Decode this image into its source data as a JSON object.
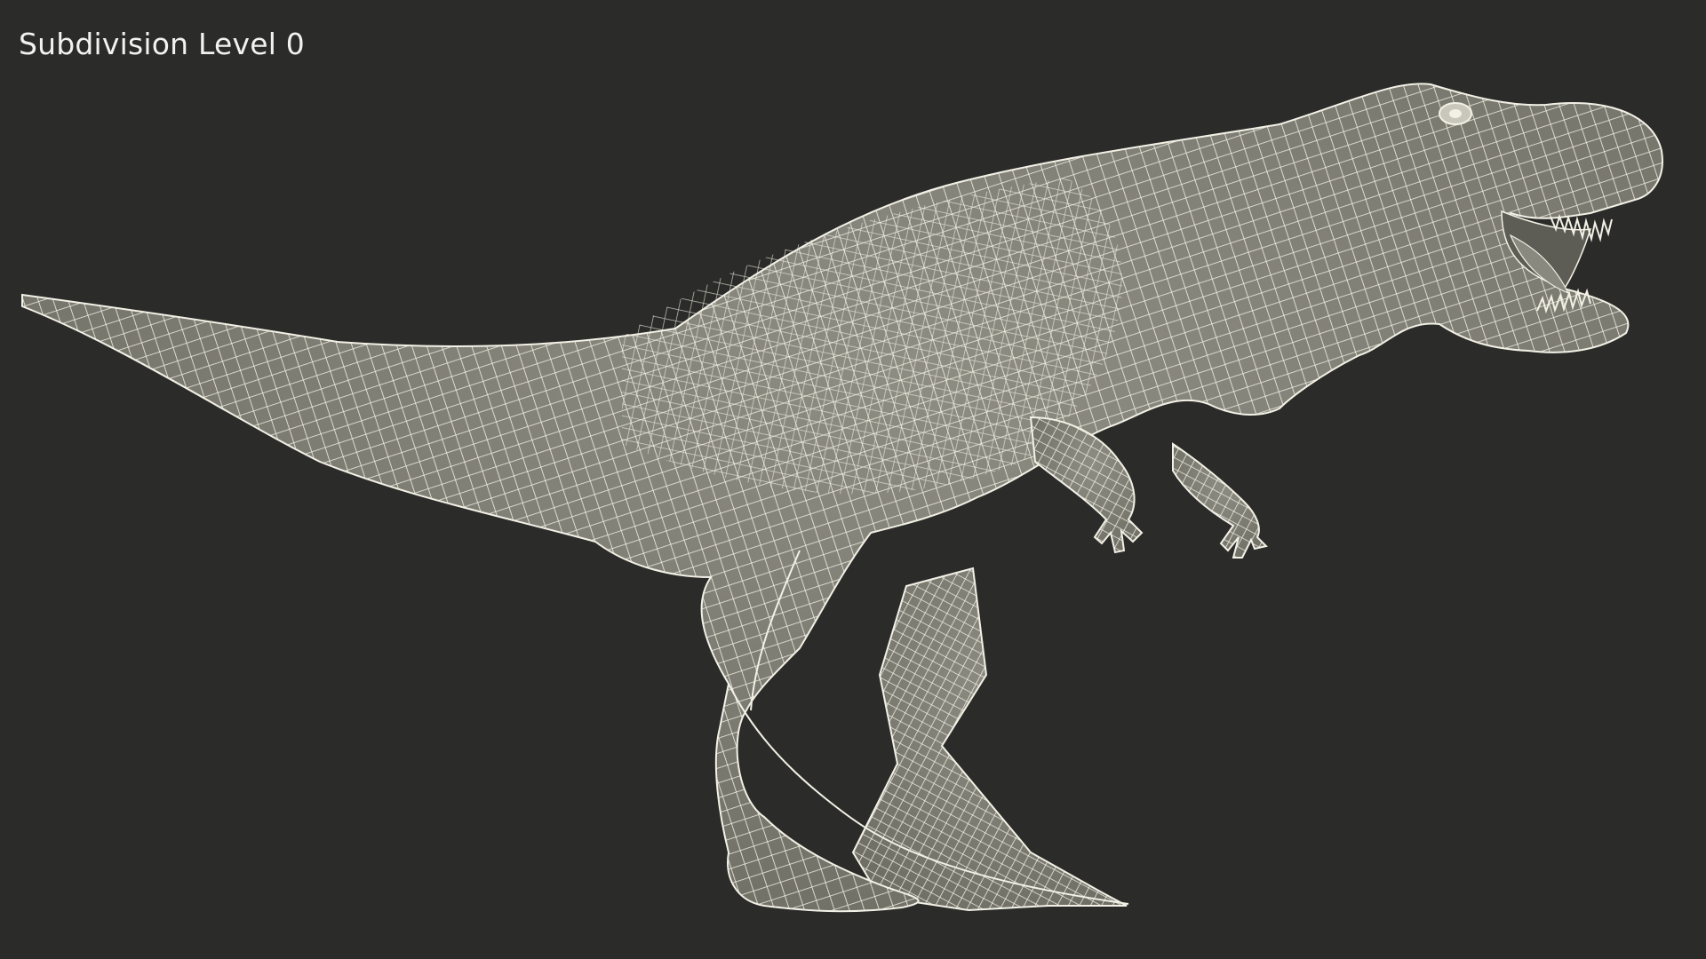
{
  "viewport": {
    "label": "Subdivision Level 0",
    "background": "#2b2b29"
  },
  "model": {
    "subject": "tyrannosaurus-rex",
    "display_mode": "wireframe-over-shaded",
    "surface_color": "#7f7e74",
    "wire_color": "#f3f1e6"
  }
}
